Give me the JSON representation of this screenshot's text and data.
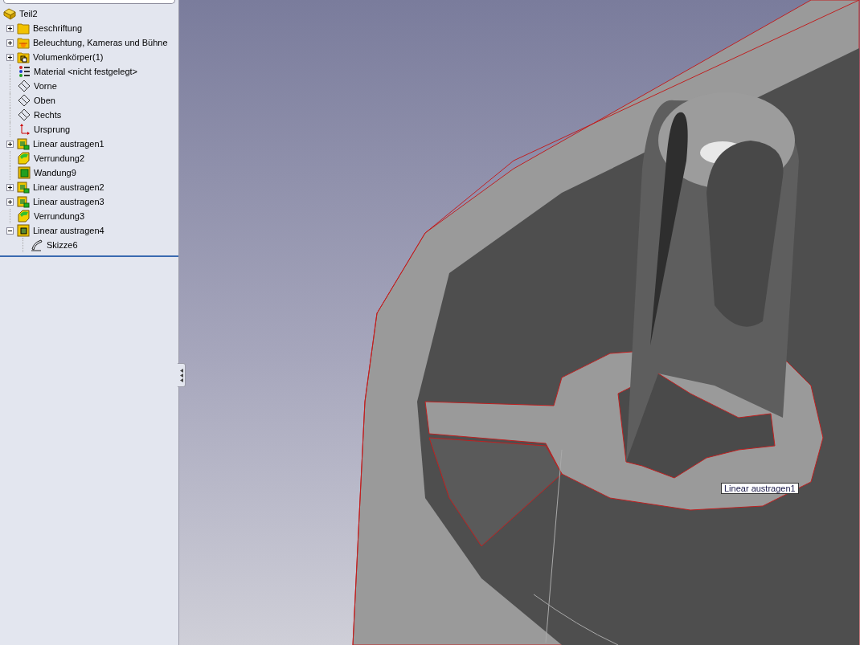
{
  "tree": {
    "label": "Teil2",
    "kind": "part",
    "children": [
      {
        "label": "Beschriftung",
        "kind": "annotations",
        "expanded": false
      },
      {
        "label": "Beleuchtung, Kameras und Bühne",
        "kind": "lights",
        "expanded": false
      },
      {
        "label": "Volumenkörper(1)",
        "kind": "bodies",
        "expanded": false
      },
      {
        "label": "Material <nicht festgelegt>",
        "kind": "material"
      },
      {
        "label": "Vorne",
        "kind": "plane"
      },
      {
        "label": "Oben",
        "kind": "plane"
      },
      {
        "label": "Rechts",
        "kind": "plane"
      },
      {
        "label": "Ursprung",
        "kind": "origin"
      },
      {
        "label": "Linear austragen1",
        "kind": "extrude",
        "expanded": false
      },
      {
        "label": "Verrundung2",
        "kind": "fillet"
      },
      {
        "label": "Wandung9",
        "kind": "shell"
      },
      {
        "label": "Linear austragen2",
        "kind": "extrude",
        "expanded": false
      },
      {
        "label": "Linear austragen3",
        "kind": "extrude",
        "expanded": false
      },
      {
        "label": "Verrundung3",
        "kind": "fillet"
      },
      {
        "label": "Linear austragen4",
        "kind": "cut",
        "expanded": true,
        "children": [
          {
            "label": "Skizze6",
            "kind": "sketch"
          }
        ]
      }
    ]
  },
  "tooltip": "Linear austragen1"
}
